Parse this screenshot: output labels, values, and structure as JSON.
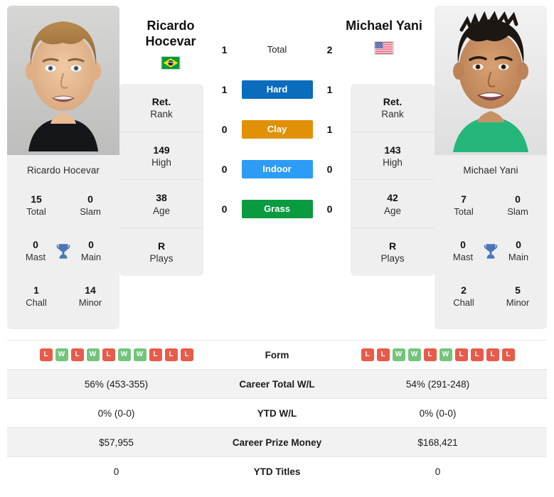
{
  "players": {
    "left": {
      "name": "Ricardo Hocevar",
      "name_line1": "Ricardo",
      "name_line2": "Hocevar",
      "country": "Brazil",
      "flag": "brazil-flag",
      "photo": "player-photo-hocevar",
      "titles": {
        "total_num": "15",
        "total_lbl": "Total",
        "slam_num": "0",
        "slam_lbl": "Slam",
        "mast_num": "0",
        "mast_lbl": "Mast",
        "main_num": "0",
        "main_lbl": "Main",
        "chall_num": "1",
        "chall_lbl": "Chall",
        "minor_num": "14",
        "minor_lbl": "Minor"
      },
      "info": [
        {
          "value": "Ret.",
          "label": "Rank"
        },
        {
          "value": "149",
          "label": "High"
        },
        {
          "value": "38",
          "label": "Age"
        },
        {
          "value": "R",
          "label": "Plays"
        }
      ],
      "form": [
        "L",
        "W",
        "L",
        "W",
        "L",
        "W",
        "W",
        "L",
        "L",
        "L"
      ],
      "career_total_wl": "56% (453-355)",
      "ytd_wl": "0% (0-0)",
      "career_prize_money": "$57,955",
      "ytd_titles": "0"
    },
    "right": {
      "name": "Michael Yani",
      "name_line1": "Michael Yani",
      "name_line2": "",
      "country": "United States",
      "flag": "usa-flag",
      "photo": "player-photo-yani",
      "titles": {
        "total_num": "7",
        "total_lbl": "Total",
        "slam_num": "0",
        "slam_lbl": "Slam",
        "mast_num": "0",
        "mast_lbl": "Mast",
        "main_num": "0",
        "main_lbl": "Main",
        "chall_num": "2",
        "chall_lbl": "Chall",
        "minor_num": "5",
        "minor_lbl": "Minor"
      },
      "info": [
        {
          "value": "Ret.",
          "label": "Rank"
        },
        {
          "value": "143",
          "label": "High"
        },
        {
          "value": "42",
          "label": "Age"
        },
        {
          "value": "R",
          "label": "Plays"
        }
      ],
      "form": [
        "L",
        "L",
        "W",
        "W",
        "L",
        "W",
        "L",
        "L",
        "L",
        "L"
      ],
      "career_total_wl": "54% (291-248)",
      "ytd_wl": "0% (0-0)",
      "career_prize_money": "$168,421",
      "ytd_titles": "0"
    }
  },
  "head_to_head": [
    {
      "label": "Total",
      "left": "1",
      "right": "2",
      "type": "text",
      "color": ""
    },
    {
      "label": "Hard",
      "left": "1",
      "right": "1",
      "type": "surface",
      "color": "#0a6cbd"
    },
    {
      "label": "Clay",
      "left": "0",
      "right": "1",
      "type": "surface",
      "color": "#e09106"
    },
    {
      "label": "Indoor",
      "left": "0",
      "right": "0",
      "type": "surface",
      "color": "#2d9cf5"
    },
    {
      "label": "Grass",
      "left": "0",
      "right": "0",
      "type": "surface",
      "color": "#0a9a3f"
    }
  ],
  "table": {
    "rows": [
      {
        "label": "Form",
        "kind": "form",
        "left": "",
        "right": "",
        "shaded": false
      },
      {
        "label": "Career Total W/L",
        "kind": "text",
        "left": "56% (453-355)",
        "right": "54% (291-248)",
        "shaded": true
      },
      {
        "label": "YTD W/L",
        "kind": "text",
        "left": "0% (0-0)",
        "right": "0% (0-0)",
        "shaded": false
      },
      {
        "label": "Career Prize Money",
        "kind": "text",
        "left": "$57,955",
        "right": "$168,421",
        "shaded": true
      },
      {
        "label": "YTD Titles",
        "kind": "text",
        "left": "0",
        "right": "0",
        "shaded": false
      }
    ]
  },
  "colors": {
    "win_badge": "#e8a",
    "win": "#74c47b",
    "loss": "#e85a4a",
    "card_bg": "#efefef",
    "row_shaded": "#f2f2f2",
    "trophy": "#4a76b8"
  },
  "icons": {
    "trophy": "trophy-icon"
  }
}
